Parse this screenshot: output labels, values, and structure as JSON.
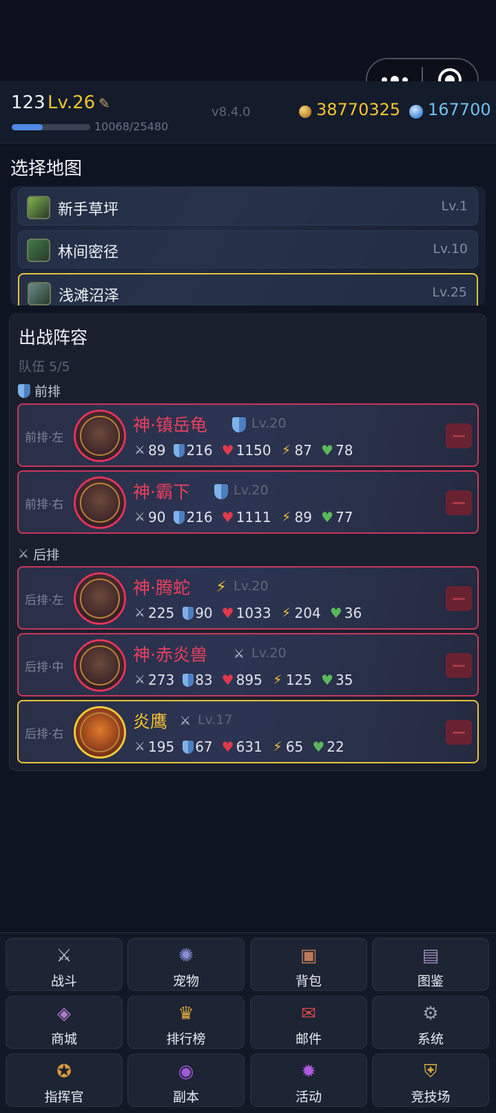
{
  "top": {
    "more_icon": "more-dots-icon",
    "close_icon": "target-circle-icon"
  },
  "player": {
    "name": "123",
    "level": "Lv.26",
    "xp_text": "10068/25480",
    "xp_fraction": 0.395,
    "version": "v8.4.0",
    "gold": "38770325",
    "gems": "167700"
  },
  "map_section": {
    "title": "选择地图",
    "maps": [
      {
        "name": "新手草坪",
        "level": "Lv.1",
        "thumb_color": "#7fb34a"
      },
      {
        "name": "林间密径",
        "level": "Lv.10",
        "thumb_color": "#3f7a4a"
      },
      {
        "name": "浅滩沼泽",
        "level": "Lv.25",
        "thumb_color": "#6b8a8a"
      }
    ]
  },
  "team": {
    "title": "出战阵容",
    "count": "队伍 5/5",
    "front_label": "前排",
    "back_label": "后排",
    "front": [
      {
        "slot": "前排·左",
        "name": "神·镇岳龟",
        "type": "shield",
        "level": "Lv.20",
        "atk": "89",
        "def": "216",
        "hp": "1150",
        "spd": "87",
        "heal": "78"
      },
      {
        "slot": "前排·右",
        "name": "神·霸下",
        "type": "shield",
        "level": "Lv.20",
        "atk": "90",
        "def": "216",
        "hp": "1111",
        "spd": "89",
        "heal": "77"
      }
    ],
    "back": [
      {
        "slot": "后排·左",
        "name": "神·腾蛇",
        "type": "bolt",
        "level": "Lv.20",
        "atk": "225",
        "def": "90",
        "hp": "1033",
        "spd": "204",
        "heal": "36"
      },
      {
        "slot": "后排·中",
        "name": "神·赤炎兽",
        "type": "sword",
        "level": "Lv.20",
        "atk": "273",
        "def": "83",
        "hp": "895",
        "spd": "125",
        "heal": "35"
      },
      {
        "slot": "后排·右",
        "name": "炎鹰",
        "type": "sword",
        "level": "Lv.17",
        "atk": "195",
        "def": "67",
        "hp": "631",
        "spd": "65",
        "heal": "22"
      }
    ]
  },
  "nav": [
    {
      "label": "战斗",
      "icon": "crossed-swords-icon"
    },
    {
      "label": "宠物",
      "icon": "pet-orb-icon"
    },
    {
      "label": "背包",
      "icon": "backpack-icon"
    },
    {
      "label": "图鉴",
      "icon": "book-icon"
    },
    {
      "label": "商城",
      "icon": "shop-chest-icon"
    },
    {
      "label": "排行榜",
      "icon": "trophy-icon"
    },
    {
      "label": "邮件",
      "icon": "mail-icon"
    },
    {
      "label": "系统",
      "icon": "gear-icon"
    },
    {
      "label": "指挥官",
      "icon": "commander-icon"
    },
    {
      "label": "副本",
      "icon": "portal-icon"
    },
    {
      "label": "活动",
      "icon": "event-icon"
    },
    {
      "label": "竞技场",
      "icon": "arena-shield-icon"
    }
  ]
}
